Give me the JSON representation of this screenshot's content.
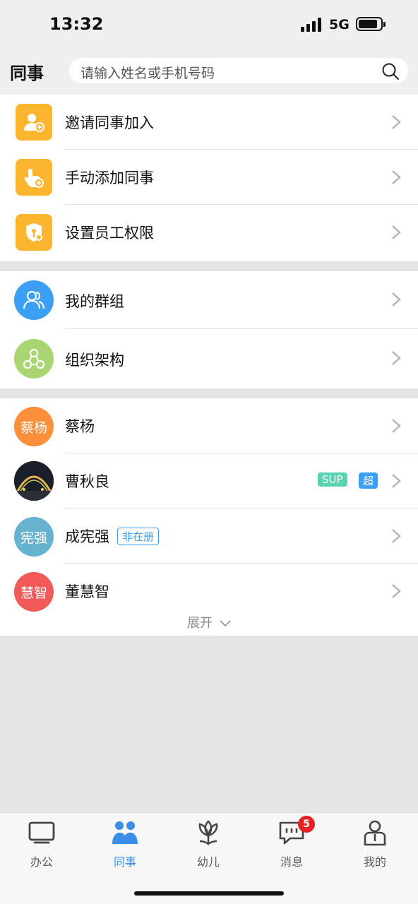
{
  "status_bar": {
    "time": "13:32",
    "network": "5G"
  },
  "header": {
    "title": "同事",
    "search_placeholder": "请输入姓名或手机号码"
  },
  "actions": [
    {
      "label": "邀请同事加入",
      "icon": "invite-user-icon"
    },
    {
      "label": "手动添加同事",
      "icon": "add-manual-icon"
    },
    {
      "label": "设置员工权限",
      "icon": "permission-icon"
    }
  ],
  "groups": [
    {
      "label": "我的群组",
      "icon": "group-icon",
      "color": "#3a9ff5"
    },
    {
      "label": "组织架构",
      "icon": "org-chart-icon",
      "color": "#a9d672"
    }
  ],
  "colleagues": [
    {
      "name": "蔡杨",
      "avatar_text": "蔡杨",
      "avatar_color": "#fb8f3a"
    },
    {
      "name": "曹秋良",
      "avatar_text": "",
      "avatar_color": "#1e2430",
      "tags": [
        "SUP",
        "超"
      ]
    },
    {
      "name": "成宪强",
      "avatar_text": "宪强",
      "avatar_color": "#66b3cf",
      "status": "非在册"
    },
    {
      "name": "董慧智",
      "avatar_text": "慧智",
      "avatar_color": "#f25a5a"
    }
  ],
  "expand_label": "展开",
  "tabs": [
    {
      "label": "办公",
      "icon": "monitor-icon"
    },
    {
      "label": "同事",
      "icon": "colleagues-icon",
      "active": true
    },
    {
      "label": "幼儿",
      "icon": "flower-icon"
    },
    {
      "label": "消息",
      "icon": "message-icon",
      "badge": "5"
    },
    {
      "label": "我的",
      "icon": "profile-icon"
    }
  ],
  "colors": {
    "accent": "#3a8ee6",
    "action_icon_bg": "#fbb52e",
    "sup_tag": "#58d3b1",
    "super_tag": "#3a9ff5"
  }
}
